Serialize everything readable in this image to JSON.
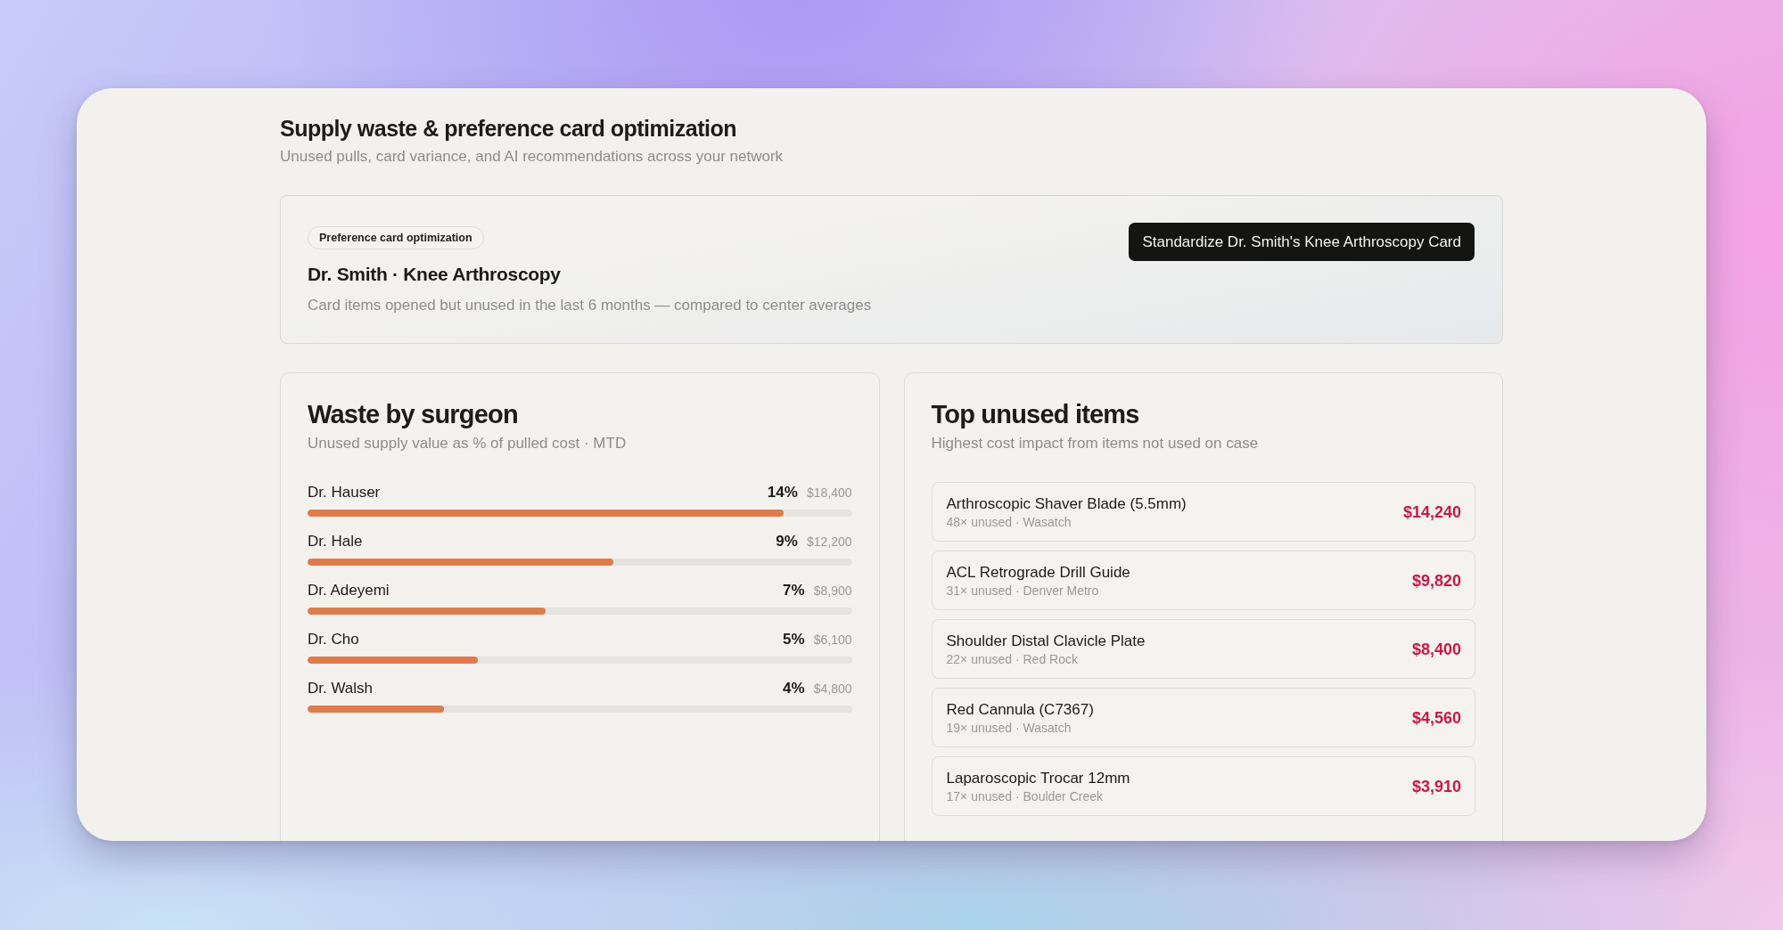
{
  "header": {
    "title": "Supply waste & preference card optimization",
    "subtitle": "Unused pulls, card variance, and AI recommendations across your network"
  },
  "banner": {
    "tag": "Preference card optimization",
    "title": "Dr. Smith · Knee Arthroscopy",
    "description": "Card items opened but unused in the last 6 months — compared to center averages",
    "button": "Standardize Dr. Smith's Knee Arthroscopy Card"
  },
  "waste_by_surgeon": {
    "title": "Waste by surgeon",
    "subtitle": "Unused supply value as % of pulled cost · MTD",
    "rows": [
      {
        "name": "Dr. Hauser",
        "percent": "14%",
        "amount": "$18,400",
        "level": 0.875
      },
      {
        "name": "Dr. Hale",
        "percent": "9%",
        "amount": "$12,200",
        "level": 0.5625
      },
      {
        "name": "Dr. Adeyemi",
        "percent": "7%",
        "amount": "$8,900",
        "level": 0.4375
      },
      {
        "name": "Dr. Cho",
        "percent": "5%",
        "amount": "$6,100",
        "level": 0.3125
      },
      {
        "name": "Dr. Walsh",
        "percent": "4%",
        "amount": "$4,800",
        "level": 0.25
      }
    ]
  },
  "top_unused_items": {
    "title": "Top unused items",
    "subtitle": "Highest cost impact from items not used on case",
    "items": [
      {
        "name": "Arthroscopic Shaver Blade (5.5mm)",
        "detail": "48× unused · Wasatch",
        "cost": "$14,240"
      },
      {
        "name": "ACL Retrograde Drill Guide",
        "detail": "31× unused · Denver Metro",
        "cost": "$9,820"
      },
      {
        "name": "Shoulder Distal Clavicle Plate",
        "detail": "22× unused · Red Rock",
        "cost": "$8,400"
      },
      {
        "name": "Red Cannula (C7367)",
        "detail": "19× unused · Wasatch",
        "cost": "$4,560"
      },
      {
        "name": "Laparoscopic Trocar 12mm",
        "detail": "17× unused · Boulder Creek",
        "cost": "$3,910"
      }
    ]
  }
}
